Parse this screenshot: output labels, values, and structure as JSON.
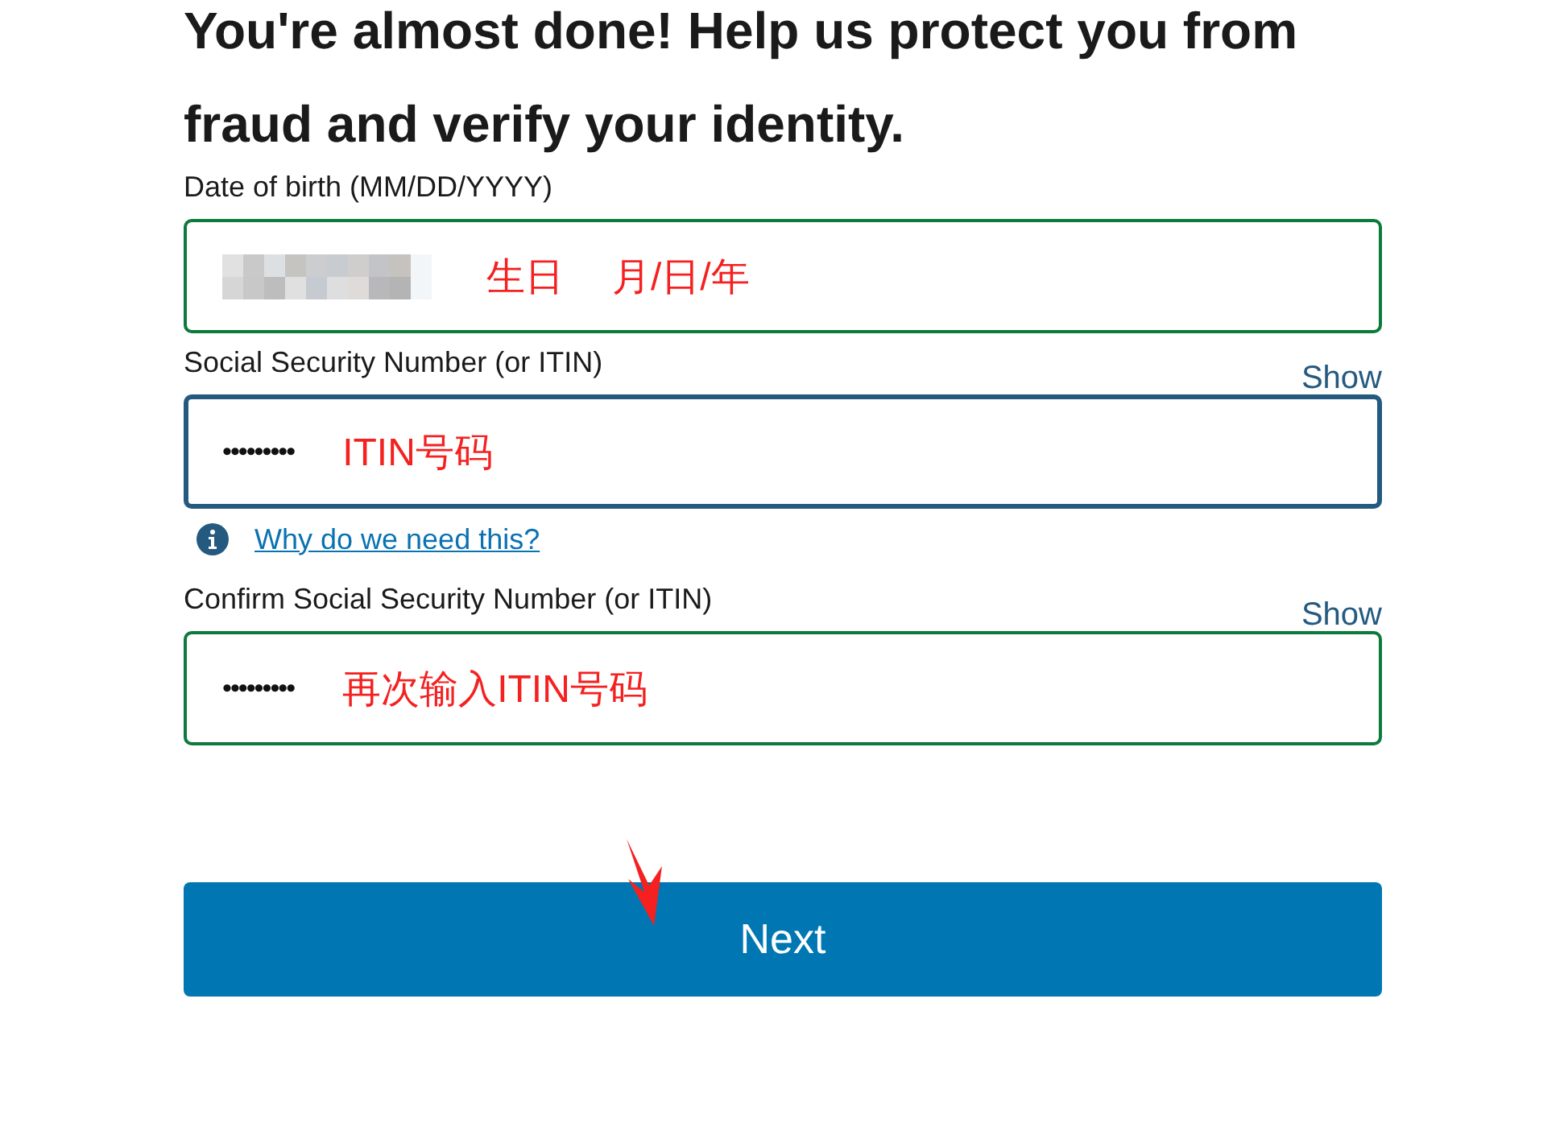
{
  "heading": "You're almost done! Help us protect you from fraud and verify your identity.",
  "fields": [
    {
      "label": "Date of birth (MM/DD/YYYY)",
      "kind": "redacted",
      "focused": false,
      "valid": true,
      "annotations": [
        "生日",
        "月/日/年"
      ]
    },
    {
      "label": "Social Security Number (or ITIN)",
      "toggle": "Show",
      "kind": "masked",
      "value": "•••••••••",
      "focused": true,
      "valid": false,
      "annotations": [
        "ITIN号码"
      ],
      "help_link": "Why do we need this?"
    },
    {
      "label": "Confirm Social Security Number (or ITIN)",
      "toggle": "Show",
      "kind": "masked",
      "value": "•••••••••",
      "focused": false,
      "valid": true,
      "annotations": [
        "再次输入ITIN号码"
      ]
    }
  ],
  "next_button": "Next"
}
